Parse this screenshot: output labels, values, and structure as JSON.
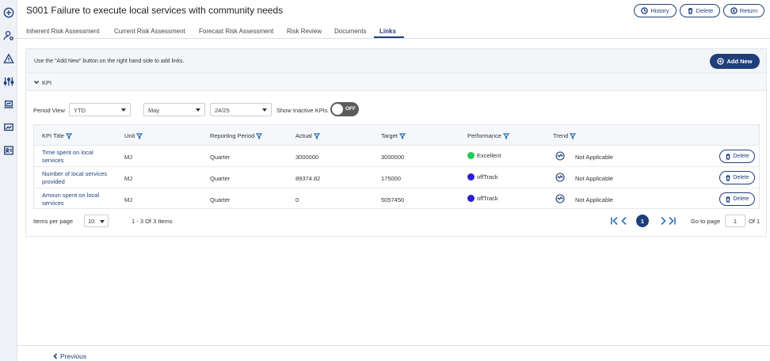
{
  "page": {
    "title": "S001 Failure to execute local services with community needs",
    "history_label": "History",
    "delete_label": "Delete",
    "return_label": "Return"
  },
  "tabs": [
    {
      "label": "Inherent Risk Assessment"
    },
    {
      "label": "Current Risk Assessment"
    },
    {
      "label": "Forecast Risk Assessment"
    },
    {
      "label": "Risk Review"
    },
    {
      "label": "Documents"
    },
    {
      "label": "Links",
      "active": true
    }
  ],
  "links": {
    "info_text": "Use the \"Add New\" button on the right hand side to add links.",
    "add_new_label": "Add New",
    "section_label": "KPI"
  },
  "filters": {
    "period_view_label": "Period View",
    "period_view_value": "YTD",
    "month_value": "May",
    "year_value": "24/25",
    "show_inactive_label": "Show Inactive KPIs",
    "toggle_text": "OFF"
  },
  "table": {
    "headers": [
      "KPI Title",
      "Unit",
      "Reporting Period",
      "Actual",
      "Target",
      "Performance",
      "Trend"
    ],
    "rows": [
      {
        "title_line1": "Time spent on local",
        "title_line2": "services",
        "unit": "MJ",
        "period": "Quarter",
        "actual": "3000000",
        "target": "3000000",
        "performance": "Excellent",
        "perf_color": "#22cc55",
        "trend": "Not Applicable",
        "delete": "Delete"
      },
      {
        "title_line1": "Number of local services",
        "title_line2": "provided",
        "unit": "MJ",
        "period": "Quarter",
        "actual": "89374.82",
        "target": "175000",
        "performance": "offTrack",
        "perf_color": "#2a1fd6",
        "trend": "Not Applicable",
        "delete": "Delete"
      },
      {
        "title_line1": "Amoun spent on local",
        "title_line2": "services",
        "unit": "MJ",
        "period": "Quarter",
        "actual": "0",
        "target": "5057450",
        "performance": "offTrack",
        "perf_color": "#2a1fd6",
        "trend": "Not Applicable",
        "delete": "Delete"
      }
    ]
  },
  "pager": {
    "items_per_page_label": "Items per page",
    "items_per_page_value": "10",
    "range_text": "1 - 3 Of 3 Items",
    "current_page": "1",
    "goto_label": "Go to page",
    "goto_value": "1",
    "of_text": "Of 1"
  },
  "footer": {
    "previous_label": "Previous"
  },
  "colors": {
    "accent": "#1f3f7a",
    "filter_icon": "#2a72b8"
  },
  "icons": [
    "plus-circle-icon",
    "user-settings-icon",
    "warning-icon",
    "sliders-icon",
    "laptop-icon",
    "chart-monitor-icon",
    "id-card-icon"
  ]
}
